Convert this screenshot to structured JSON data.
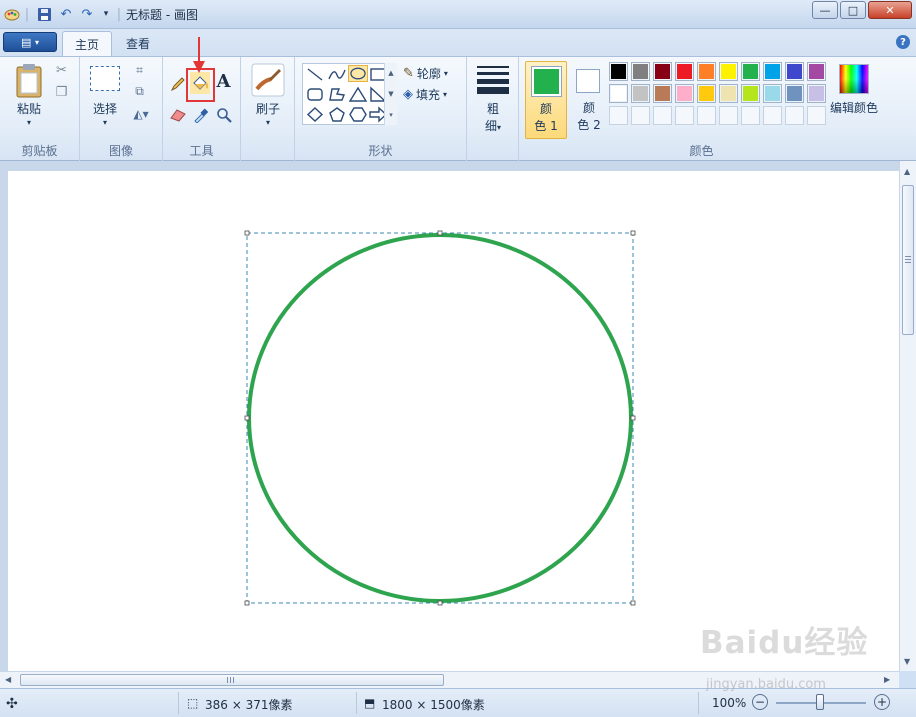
{
  "window": {
    "title": "无标题 - 画图",
    "minimize": "—",
    "maximize": "□",
    "close": "✕"
  },
  "tabs": [
    {
      "label": "主页"
    },
    {
      "label": "查看"
    }
  ],
  "ribbon": {
    "clipboard": {
      "group": "剪贴板",
      "paste": "粘贴"
    },
    "image": {
      "group": "图像",
      "select": "选择"
    },
    "tools": {
      "group": "工具",
      "text_glyph": "A"
    },
    "brushes": {
      "label": "刷子"
    },
    "shapes": {
      "group": "形状",
      "outline": "轮廓",
      "fill": "填充"
    },
    "size": {
      "label_1": "粗",
      "label_2": "细"
    },
    "colors": {
      "group": "颜色",
      "color1_label_1": "颜",
      "color1_label_2": "色 1",
      "color2_label_1": "颜",
      "color2_label_2": "色 2",
      "edit": "编辑颜色",
      "color1_value": "#22b14c",
      "color2_value": "#ffffff",
      "palette_row1": [
        "#000000",
        "#7f7f7f",
        "#880015",
        "#ed1c24",
        "#ff7f27",
        "#fff200",
        "#22b14c",
        "#00a2e8",
        "#3f48cc",
        "#a349a4"
      ],
      "palette_row2": [
        "#ffffff",
        "#c3c3c3",
        "#b97a57",
        "#ffaec9",
        "#ffc90e",
        "#efe4b0",
        "#b5e61d",
        "#99d9ea",
        "#7092be",
        "#c8bfe7"
      ]
    }
  },
  "canvas": {
    "shape_color": "#2ea44f"
  },
  "status": {
    "selection_size": "386 × 371像素",
    "canvas_size": "1800 × 1500像素",
    "zoom": "100%"
  },
  "watermark": {
    "brand": "Baidu经验",
    "url": "jingyan.baidu.com"
  }
}
